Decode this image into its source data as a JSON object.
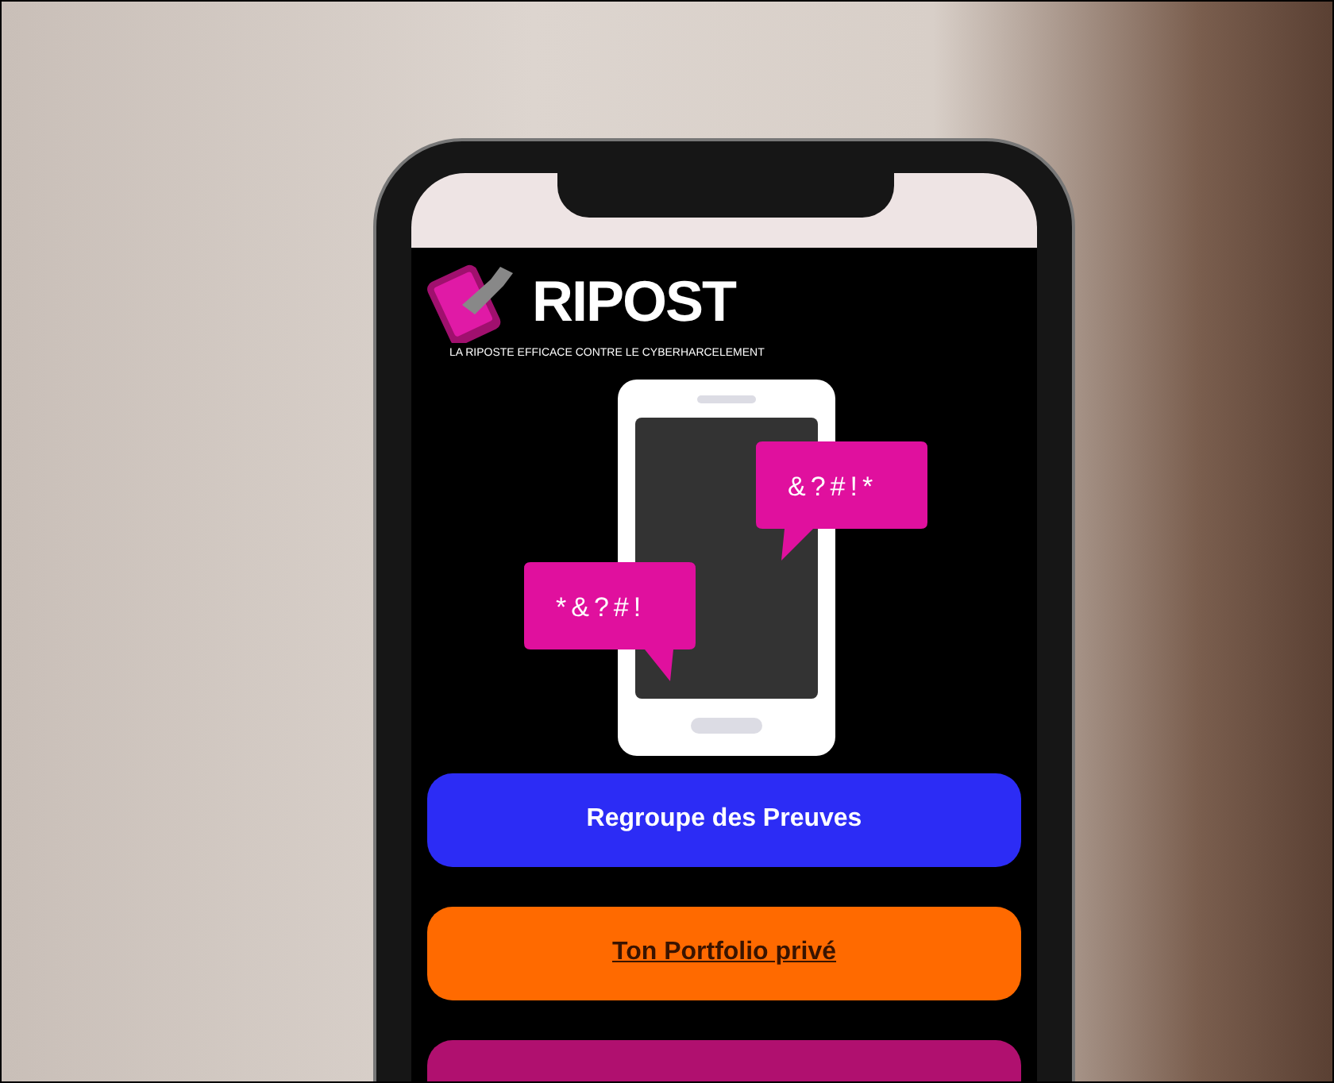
{
  "app": {
    "title": "RIPOST",
    "tagline": "LA RIPOSTE EFFICACE CONTRE LE CYBERHARCELEMENT"
  },
  "illustration": {
    "bubbles": [
      {
        "text": "&?#!*"
      },
      {
        "text": "*&?#!"
      }
    ]
  },
  "buttons": [
    {
      "label": "Regroupe des Preuves",
      "kind": "solid",
      "color": "#2c2cf5"
    },
    {
      "label": "Ton Portfolio privé",
      "kind": "link",
      "color": "#ff6a00"
    },
    {
      "kind": "solid",
      "color": "#b0106f"
    }
  ]
}
